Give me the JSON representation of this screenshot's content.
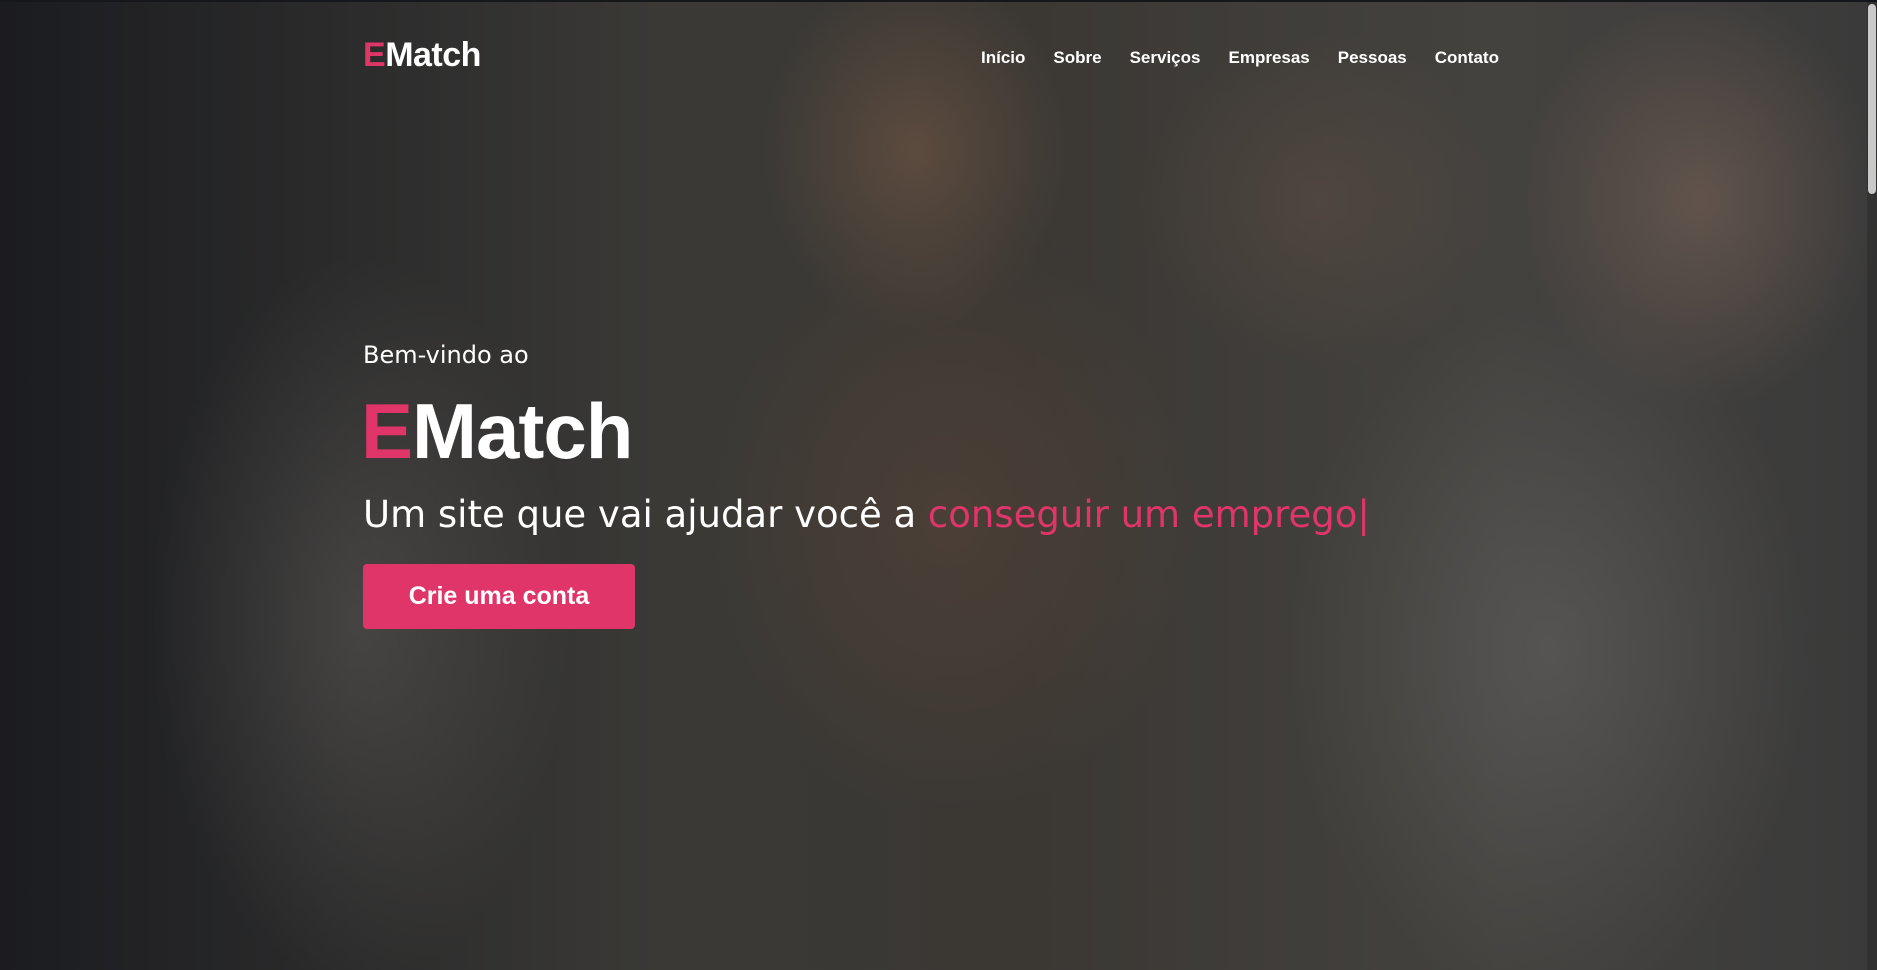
{
  "brand": {
    "prefix": "E",
    "rest": "Match",
    "accent_color": "#e03569"
  },
  "nav": {
    "items": [
      {
        "label": "Início"
      },
      {
        "label": "Sobre"
      },
      {
        "label": "Serviços"
      },
      {
        "label": "Empresas"
      },
      {
        "label": "Pessoas"
      },
      {
        "label": "Contato"
      }
    ]
  },
  "hero": {
    "welcome": "Bem-vindo ao",
    "title_prefix": "E",
    "title_rest": "Match",
    "tagline_static": "Um site que vai ajudar você a ",
    "tagline_typed": "conseguir um emprego",
    "cursor": "|",
    "cta_label": "Crie uma conta",
    "background_icon": "team-hands-photo"
  }
}
